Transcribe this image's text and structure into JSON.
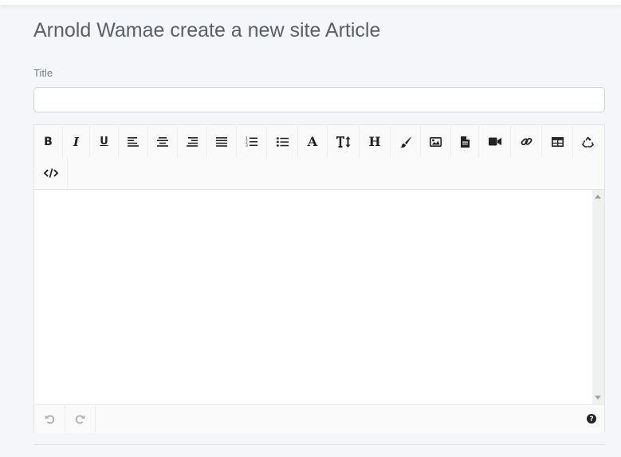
{
  "page": {
    "title": "Arnold Wamae create a new site Article"
  },
  "form": {
    "title_label": "Title",
    "title_value": "",
    "title_placeholder": ""
  },
  "editor": {
    "toolbar_row1": [
      {
        "name": "bold-button",
        "icon": "bold-icon"
      },
      {
        "name": "italic-button",
        "icon": "italic-icon"
      },
      {
        "name": "underline-button",
        "icon": "underline-icon"
      },
      {
        "name": "align-left-button",
        "icon": "align-left-icon"
      },
      {
        "name": "align-center-button",
        "icon": "align-center-icon"
      },
      {
        "name": "align-right-button",
        "icon": "align-right-icon"
      },
      {
        "name": "align-justify-button",
        "icon": "align-justify-icon"
      },
      {
        "name": "ordered-list-button",
        "icon": "ordered-list-icon"
      },
      {
        "name": "unordered-list-button",
        "icon": "unordered-list-icon"
      },
      {
        "name": "font-button",
        "icon": "font-icon"
      },
      {
        "name": "font-size-button",
        "icon": "text-height-icon"
      },
      {
        "name": "heading-button",
        "icon": "header-icon"
      },
      {
        "name": "color-button",
        "icon": "paint-brush-icon"
      },
      {
        "name": "insert-image-button",
        "icon": "image-icon"
      },
      {
        "name": "insert-file-button",
        "icon": "file-icon"
      },
      {
        "name": "insert-video-button",
        "icon": "video-icon"
      },
      {
        "name": "insert-link-button",
        "icon": "link-icon"
      },
      {
        "name": "insert-table-button",
        "icon": "table-icon"
      },
      {
        "name": "clear-format-button",
        "icon": "recycle-icon"
      }
    ],
    "toolbar_row2": [
      {
        "name": "code-view-button",
        "icon": "code-icon"
      }
    ],
    "glyphs": {
      "bold": "B",
      "italic": "I",
      "underline": "U",
      "font": "A",
      "heading": "H"
    },
    "content": "",
    "statusbar": {
      "undo_icon": "undo-icon",
      "redo_icon": "redo-icon",
      "help_icon": "question-circle-icon"
    }
  },
  "colors": {
    "background": "#f5f6fa",
    "title_text": "#5c6066",
    "icon": "#222222",
    "disabled_icon": "#b0b0b0"
  }
}
